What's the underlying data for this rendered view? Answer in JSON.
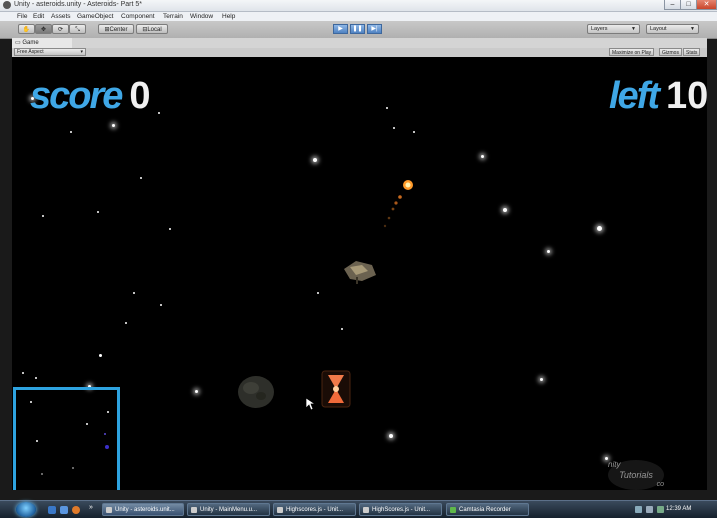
{
  "window": {
    "title": "Unity - asteroids.unity - Asteroids- Part 5*",
    "minimize": "–",
    "maximize": "□",
    "close": "✕"
  },
  "menu": [
    "File",
    "Edit",
    "Assets",
    "GameObject",
    "Component",
    "Terrain",
    "Window",
    "Help"
  ],
  "toolbar": {
    "hand_icon": "hand-icon",
    "move_icon": "move-icon",
    "rotate_icon": "rotate-icon",
    "scale_icon": "scale-icon",
    "pivot_label": "Center",
    "space_label": "Local",
    "play_icon": "▶",
    "pause_icon": "❚❚",
    "step_icon": "▶|",
    "layers_label": "Layers",
    "layout_label": "Layout"
  },
  "game_view": {
    "tab_label": "Game",
    "aspect_label": "Free Aspect",
    "maximize_label": "Maximize on Play",
    "gizmos_label": "Gizmos",
    "stats_label": "Stats"
  },
  "hud": {
    "score_label": "score",
    "score_value": "0",
    "left_label": "left",
    "left_value": "10"
  },
  "watermark": {
    "line1": "nity",
    "line2": "Tutorials",
    "line3": "co"
  },
  "taskbar": {
    "items": [
      "Unity - asteroids.unit...",
      "Unity - MainMenu.u...",
      "Highscores.js - Unit...",
      "HighScores.js - Unit...",
      "Camtasia Recorder"
    ],
    "clock": "12:39 AM"
  },
  "colors": {
    "hud_label": "#3fa7e6",
    "hud_value": "#f0f0f0",
    "minimap_border": "#2ea3e0",
    "viewport_bg": "#000000"
  }
}
